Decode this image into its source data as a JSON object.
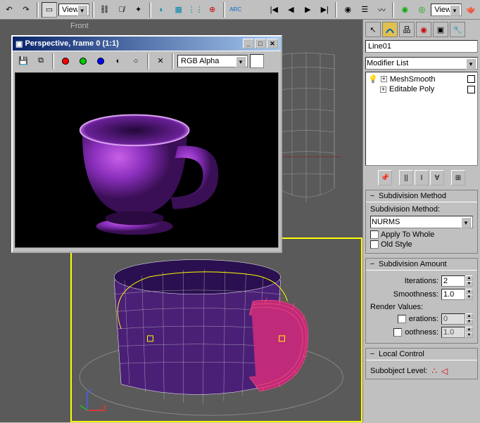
{
  "toolbar": {
    "view_label": "View",
    "view_label2": "View"
  },
  "viewport": {
    "front_label": "Front"
  },
  "preview": {
    "title": "Perspective, frame 0 (1:1)",
    "channel": "RGB Alpha"
  },
  "side": {
    "object_name": "Line01",
    "modifier_list_label": "Modifier List",
    "mods": [
      {
        "name": "MeshSmooth"
      },
      {
        "name": "Editable Poly"
      }
    ],
    "subdiv_method": {
      "title": "Subdivision Method",
      "label": "Subdivision Method:",
      "value": "NURMS",
      "whole": "Apply To Whole",
      "old": "Old Style"
    },
    "subdiv_amount": {
      "title": "Subdivision Amount",
      "iterations_label": "Iterations:",
      "iterations": "2",
      "smoothness_label": "Smoothness:",
      "smoothness": "1.0",
      "render_values": "Render Values:",
      "render_iter_label": "erations:",
      "render_iter": "0",
      "render_smooth_label": "oothness:",
      "render_smooth": "1.0"
    },
    "local": {
      "title": "Local Control",
      "subobject": "Subobject Level:"
    }
  },
  "axis": {
    "z": "z",
    "x": "x"
  }
}
